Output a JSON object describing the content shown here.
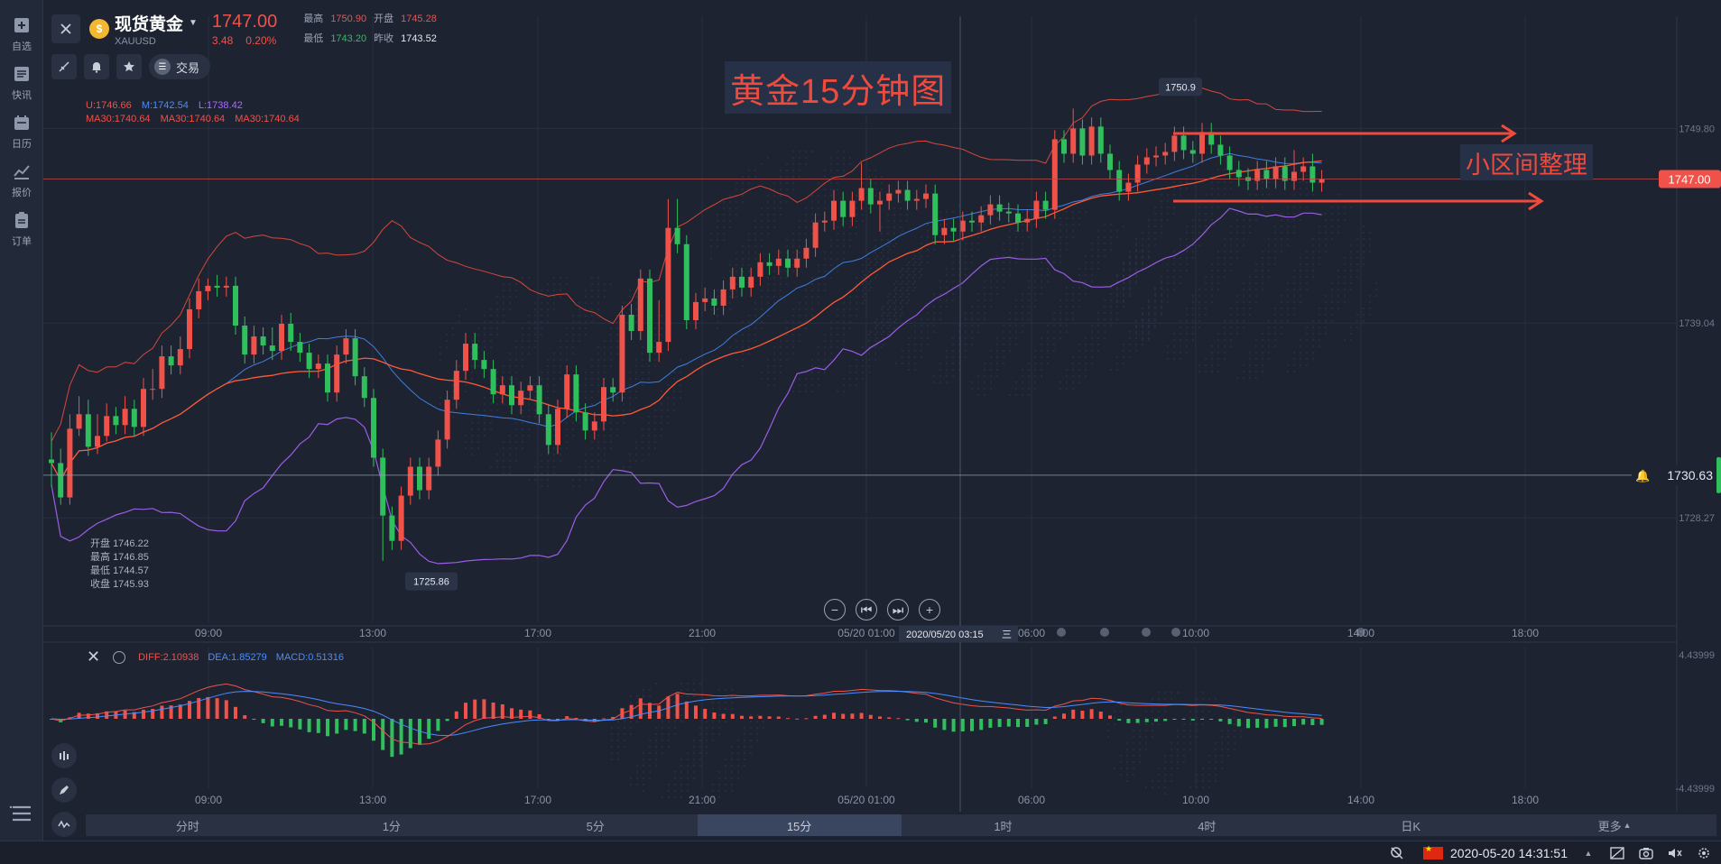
{
  "sidebar": {
    "items": [
      {
        "label": "自选",
        "icon": "plus-square-icon"
      },
      {
        "label": "快讯",
        "icon": "news-icon"
      },
      {
        "label": "日历",
        "icon": "calendar-icon"
      },
      {
        "label": "报价",
        "icon": "line-chart-icon"
      },
      {
        "label": "订单",
        "icon": "clipboard-icon"
      }
    ],
    "menu_icon": "menu-icon"
  },
  "header": {
    "symbol_name": "现货黄金",
    "symbol_code": "XAUUSD",
    "price": "1747.00",
    "change": "3.48",
    "change_pct": "0.20%",
    "high_label": "最高",
    "high": "1750.90",
    "open_label": "开盘",
    "open": "1745.28",
    "low_label": "最低",
    "low": "1743.20",
    "prev_close_label": "昨收",
    "prev_close": "1743.52",
    "trade_label": "交易",
    "trade_icon_text": "☰"
  },
  "indicators": {
    "boll_u": "U:1746.66",
    "boll_m": "M:1742.54",
    "boll_l": "L:1738.42",
    "ma_1": "MA30:1740.64",
    "ma_2": "MA30:1740.64",
    "ma_3": "MA30:1740.64"
  },
  "annotations": {
    "title": "黄金15分钟图",
    "range_note": "小区间整理",
    "high_marker": "1750.9",
    "low_marker": "1725.86",
    "alert_price": "1730.63",
    "crosshair_time": "2020/05/20 03:15",
    "crosshair_weekday": "三"
  },
  "hover_ohlc": [
    {
      "label": "开盘",
      "value": "1746.22"
    },
    {
      "label": "最高",
      "value": "1746.85"
    },
    {
      "label": "最低",
      "value": "1744.57"
    },
    {
      "label": "收盘",
      "value": "1745.93"
    }
  ],
  "price_axis": {
    "ticks": [
      "1749.80",
      "1739.04",
      "1728.27"
    ],
    "current": "1747.00"
  },
  "time_axis": [
    "09:00",
    "13:00",
    "17:00",
    "21:00",
    "05/20 01:00",
    "06:00",
    "10:00",
    "14:00",
    "18:00"
  ],
  "macd": {
    "diff": "DIFF:2.10938",
    "dea": "DEA:1.85279",
    "macd": "MACD:0.51316",
    "axis_top": "4.43999",
    "axis_bottom": "-4.43999"
  },
  "tabs": [
    {
      "label": "分时",
      "active": false
    },
    {
      "label": "1分",
      "active": false
    },
    {
      "label": "5分",
      "active": false
    },
    {
      "label": "15分",
      "active": true
    },
    {
      "label": "1时",
      "active": false
    },
    {
      "label": "4时",
      "active": false
    },
    {
      "label": "日K",
      "active": false
    },
    {
      "label": "更多",
      "active": false
    }
  ],
  "more_caret": "▲",
  "status": {
    "datetime": "2020-05-20 14:31:51"
  },
  "colors": {
    "up": "#f0524a",
    "down": "#2fbf5c",
    "boll_upper": "#d9473c",
    "boll_mid": "#3f7fe0",
    "boll_lower": "#9b5de5",
    "ma": "#ff5a36",
    "background": "#1d2331"
  },
  "chart_data": {
    "type": "candlestick",
    "price_range": [
      1722,
      1756
    ],
    "candles": [
      [
        1731.5,
        1731.3,
        1733.0,
        1730.0
      ],
      [
        1731.3,
        1729.4,
        1732.1,
        1729.0
      ],
      [
        1729.4,
        1733.2,
        1734.0,
        1729.0
      ],
      [
        1733.2,
        1734.0,
        1735.0,
        1732.8
      ],
      [
        1734.0,
        1732.2,
        1734.8,
        1731.7
      ],
      [
        1732.2,
        1732.8,
        1734.0,
        1731.8
      ],
      [
        1732.8,
        1733.9,
        1734.6,
        1732.5
      ],
      [
        1733.9,
        1733.4,
        1734.4,
        1732.9
      ],
      [
        1733.4,
        1734.3,
        1735.0,
        1732.9
      ],
      [
        1734.3,
        1733.3,
        1734.8,
        1732.8
      ],
      [
        1733.3,
        1735.4,
        1736.0,
        1732.8
      ],
      [
        1735.4,
        1735.4,
        1736.5,
        1734.8
      ],
      [
        1735.4,
        1737.2,
        1737.8,
        1734.9
      ],
      [
        1737.2,
        1736.7,
        1737.8,
        1736.2
      ],
      [
        1736.7,
        1737.6,
        1738.3,
        1736.2
      ],
      [
        1737.6,
        1739.8,
        1740.4,
        1737.1
      ],
      [
        1739.8,
        1740.8,
        1741.5,
        1739.3
      ],
      [
        1740.8,
        1741.1,
        1741.5,
        1740.3
      ],
      [
        1741.1,
        1741.0,
        1741.7,
        1740.5
      ],
      [
        1741.0,
        1741.1,
        1741.6,
        1740.5
      ],
      [
        1741.1,
        1738.9,
        1741.6,
        1738.4
      ],
      [
        1738.9,
        1737.3,
        1739.4,
        1736.8
      ],
      [
        1737.3,
        1738.3,
        1738.9,
        1736.8
      ],
      [
        1738.3,
        1737.8,
        1738.8,
        1737.3
      ],
      [
        1737.8,
        1737.5,
        1738.8,
        1737.0
      ],
      [
        1737.5,
        1739.0,
        1739.5,
        1737.0
      ],
      [
        1739.0,
        1738.0,
        1739.6,
        1737.5
      ],
      [
        1738.0,
        1737.4,
        1738.5,
        1736.9
      ],
      [
        1737.4,
        1736.5,
        1737.9,
        1736.0
      ],
      [
        1736.5,
        1736.8,
        1737.3,
        1736.0
      ],
      [
        1736.8,
        1735.2,
        1737.3,
        1734.7
      ],
      [
        1735.2,
        1737.3,
        1737.8,
        1734.7
      ],
      [
        1737.3,
        1738.2,
        1738.7,
        1736.8
      ],
      [
        1738.2,
        1736.1,
        1738.7,
        1735.6
      ],
      [
        1736.1,
        1734.9,
        1736.6,
        1734.4
      ],
      [
        1734.9,
        1731.6,
        1735.4,
        1731.1
      ],
      [
        1731.6,
        1728.4,
        1732.1,
        1725.9
      ],
      [
        1728.4,
        1727.0,
        1728.9,
        1726.5
      ],
      [
        1727.0,
        1729.5,
        1730.0,
        1726.5
      ],
      [
        1729.5,
        1731.1,
        1731.6,
        1729.0
      ],
      [
        1731.1,
        1729.8,
        1731.6,
        1729.3
      ],
      [
        1729.8,
        1731.1,
        1731.6,
        1729.3
      ],
      [
        1731.1,
        1732.6,
        1733.1,
        1730.6
      ],
      [
        1732.6,
        1734.8,
        1735.3,
        1732.1
      ],
      [
        1734.8,
        1736.4,
        1737.0,
        1734.3
      ],
      [
        1736.4,
        1737.9,
        1738.5,
        1735.9
      ],
      [
        1737.9,
        1737.0,
        1738.5,
        1736.5
      ],
      [
        1737.0,
        1736.5,
        1737.5,
        1736.0
      ],
      [
        1736.5,
        1735.1,
        1737.0,
        1734.6
      ],
      [
        1735.1,
        1735.6,
        1736.1,
        1734.6
      ],
      [
        1735.6,
        1734.5,
        1736.1,
        1734.0
      ],
      [
        1734.5,
        1735.3,
        1735.8,
        1734.0
      ],
      [
        1735.3,
        1735.6,
        1736.1,
        1734.8
      ],
      [
        1735.6,
        1734.0,
        1736.1,
        1733.5
      ],
      [
        1734.0,
        1732.3,
        1734.5,
        1731.8
      ],
      [
        1732.3,
        1734.3,
        1734.8,
        1731.8
      ],
      [
        1734.3,
        1736.2,
        1736.7,
        1733.8
      ],
      [
        1736.2,
        1734.1,
        1736.7,
        1733.6
      ],
      [
        1734.1,
        1733.1,
        1734.6,
        1732.6
      ],
      [
        1733.1,
        1733.6,
        1734.1,
        1732.6
      ],
      [
        1733.6,
        1735.5,
        1736.0,
        1733.1
      ],
      [
        1735.5,
        1735.2,
        1736.0,
        1734.7
      ],
      [
        1735.2,
        1739.5,
        1740.0,
        1734.7
      ],
      [
        1739.5,
        1738.6,
        1740.1,
        1738.1
      ],
      [
        1738.6,
        1741.5,
        1742.0,
        1738.1
      ],
      [
        1741.5,
        1737.4,
        1742.0,
        1736.9
      ],
      [
        1737.4,
        1738.0,
        1740.3,
        1736.9
      ],
      [
        1738.0,
        1744.3,
        1745.9,
        1737.5
      ],
      [
        1744.3,
        1743.4,
        1745.9,
        1742.9
      ],
      [
        1743.4,
        1739.2,
        1743.9,
        1738.7
      ],
      [
        1739.2,
        1740.2,
        1740.7,
        1738.7
      ],
      [
        1740.2,
        1740.4,
        1741.0,
        1739.7
      ],
      [
        1740.4,
        1740.0,
        1740.9,
        1739.5
      ],
      [
        1740.0,
        1740.9,
        1741.4,
        1739.5
      ],
      [
        1740.9,
        1741.6,
        1742.1,
        1740.4
      ],
      [
        1741.6,
        1741.0,
        1742.1,
        1740.5
      ],
      [
        1741.0,
        1741.6,
        1742.1,
        1740.5
      ],
      [
        1741.6,
        1742.4,
        1742.9,
        1741.1
      ],
      [
        1742.4,
        1742.2,
        1742.9,
        1741.7
      ],
      [
        1742.2,
        1742.6,
        1743.1,
        1741.7
      ],
      [
        1742.6,
        1742.1,
        1743.1,
        1741.6
      ],
      [
        1742.1,
        1742.6,
        1743.1,
        1741.6
      ],
      [
        1742.6,
        1743.2,
        1743.7,
        1742.1
      ],
      [
        1743.2,
        1744.6,
        1745.1,
        1742.7
      ],
      [
        1744.6,
        1744.7,
        1745.2,
        1744.1
      ],
      [
        1744.7,
        1745.8,
        1746.4,
        1744.2
      ],
      [
        1745.8,
        1744.9,
        1746.3,
        1744.4
      ],
      [
        1744.9,
        1745.8,
        1746.3,
        1744.4
      ],
      [
        1745.8,
        1746.5,
        1747.9,
        1745.3
      ],
      [
        1746.5,
        1745.6,
        1747.0,
        1745.1
      ],
      [
        1745.6,
        1745.8,
        1746.3,
        1744.1
      ],
      [
        1745.8,
        1746.2,
        1746.7,
        1745.3
      ],
      [
        1746.2,
        1746.4,
        1746.9,
        1745.7
      ],
      [
        1746.4,
        1745.8,
        1746.9,
        1745.3
      ],
      [
        1745.8,
        1745.9,
        1746.4,
        1745.3
      ],
      [
        1745.9,
        1746.2,
        1746.7,
        1745.4
      ],
      [
        1746.2,
        1743.9,
        1746.7,
        1743.4
      ],
      [
        1743.9,
        1744.3,
        1744.8,
        1743.4
      ],
      [
        1744.3,
        1744.1,
        1744.8,
        1743.6
      ],
      [
        1744.1,
        1744.7,
        1745.2,
        1743.6
      ],
      [
        1744.7,
        1744.6,
        1745.2,
        1744.1
      ],
      [
        1744.6,
        1745.0,
        1745.5,
        1744.1
      ],
      [
        1745.0,
        1745.6,
        1746.1,
        1744.5
      ],
      [
        1745.6,
        1745.2,
        1746.1,
        1744.7
      ],
      [
        1745.2,
        1745.1,
        1745.7,
        1744.6
      ],
      [
        1745.1,
        1744.6,
        1745.6,
        1744.1
      ],
      [
        1744.6,
        1744.8,
        1745.3,
        1744.1
      ],
      [
        1744.8,
        1745.8,
        1746.3,
        1744.3
      ],
      [
        1745.8,
        1745.3,
        1746.3,
        1744.8
      ],
      [
        1745.3,
        1749.2,
        1749.7,
        1744.8
      ],
      [
        1749.2,
        1748.4,
        1749.7,
        1747.9
      ],
      [
        1748.4,
        1749.8,
        1750.9,
        1747.9
      ],
      [
        1749.8,
        1748.3,
        1750.3,
        1747.8
      ],
      [
        1748.3,
        1749.9,
        1750.4,
        1747.8
      ],
      [
        1749.9,
        1748.4,
        1750.4,
        1747.9
      ],
      [
        1748.4,
        1747.5,
        1748.9,
        1747.0
      ],
      [
        1747.5,
        1746.3,
        1748.0,
        1745.8
      ],
      [
        1746.3,
        1746.8,
        1747.3,
        1745.8
      ],
      [
        1746.8,
        1747.8,
        1748.3,
        1746.3
      ],
      [
        1747.8,
        1748.2,
        1748.7,
        1747.3
      ],
      [
        1748.2,
        1748.3,
        1748.8,
        1747.7
      ],
      [
        1748.3,
        1748.5,
        1749.0,
        1747.8
      ],
      [
        1748.5,
        1749.4,
        1749.9,
        1748.0
      ],
      [
        1749.4,
        1748.6,
        1749.9,
        1748.1
      ],
      [
        1748.6,
        1748.4,
        1749.1,
        1747.9
      ],
      [
        1748.4,
        1749.6,
        1750.1,
        1747.9
      ],
      [
        1749.6,
        1748.9,
        1750.1,
        1748.4
      ],
      [
        1748.9,
        1748.3,
        1749.4,
        1747.8
      ],
      [
        1748.3,
        1747.5,
        1748.8,
        1747.0
      ],
      [
        1747.5,
        1747.1,
        1748.0,
        1746.6
      ],
      [
        1747.1,
        1746.9,
        1747.6,
        1746.4
      ],
      [
        1746.9,
        1747.5,
        1748.0,
        1746.4
      ],
      [
        1747.5,
        1747.0,
        1748.0,
        1746.5
      ],
      [
        1747.0,
        1747.7,
        1748.2,
        1746.5
      ],
      [
        1747.7,
        1746.9,
        1748.2,
        1746.4
      ],
      [
        1746.9,
        1747.4,
        1748.6,
        1746.4
      ],
      [
        1747.4,
        1747.7,
        1748.2,
        1746.9
      ],
      [
        1747.7,
        1746.8,
        1748.4,
        1746.3
      ],
      [
        1746.8,
        1747.0,
        1747.5,
        1746.3
      ]
    ],
    "macd_hist_range": [
      -4.44,
      4.44
    ]
  }
}
